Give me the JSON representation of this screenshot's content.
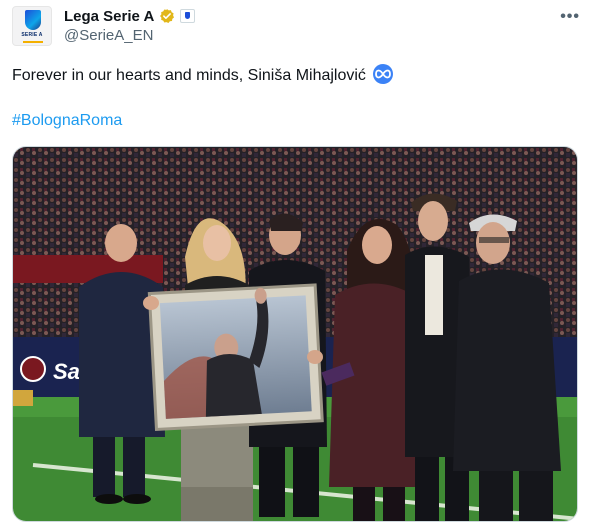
{
  "account": {
    "name": "Lega Serie A",
    "handle": "@SerieA_EN",
    "avatar_text": "SERIE A",
    "verified_icon": "verified-gold-badge-icon",
    "affiliate_icon": "serie-a-affiliate-badge-icon"
  },
  "tweet": {
    "text": "Forever in our hearts and minds, Siniša Mihajlović",
    "emoji": "infinity-emoji-icon",
    "hashtag": "#BolognaRoma"
  },
  "media": {
    "description_icon": "photo-icon",
    "board_text": "Sa"
  },
  "colors": {
    "link": "#1d9bf0",
    "secondary_text": "#536471",
    "pitch": "#3f8a34"
  }
}
